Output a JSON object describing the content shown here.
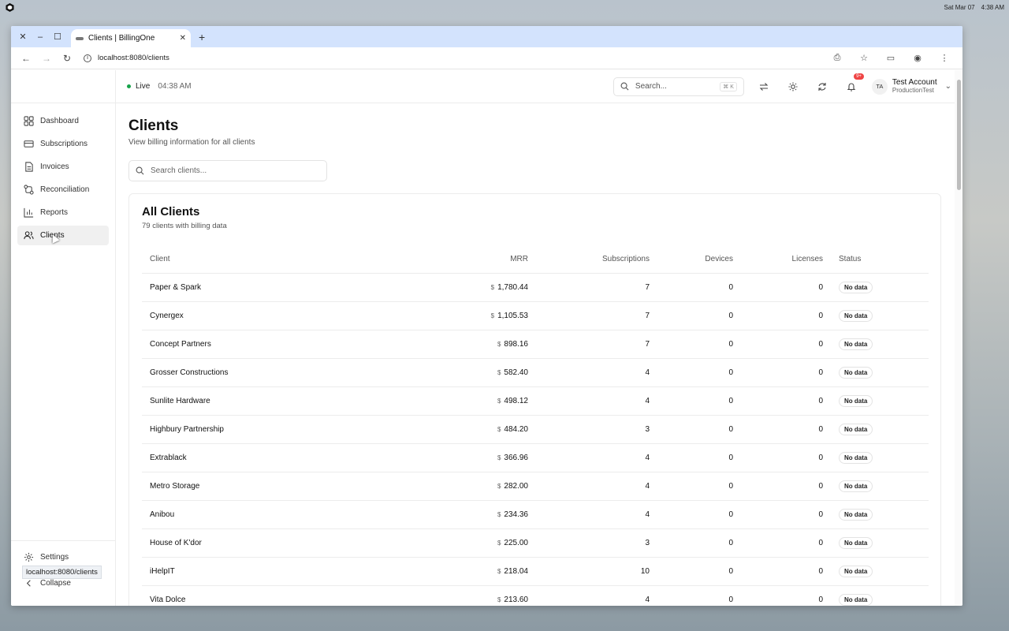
{
  "os": {
    "date": "Sat Mar 07",
    "time": "4:38 AM"
  },
  "browser": {
    "tab_title": "Clients | BillingOne",
    "url": "localhost:8080/clients",
    "status_url": "localhost:8080/clients"
  },
  "sidebar": {
    "items": [
      {
        "label": "Dashboard",
        "icon": "dashboard-icon"
      },
      {
        "label": "Subscriptions",
        "icon": "card-icon"
      },
      {
        "label": "Invoices",
        "icon": "document-icon"
      },
      {
        "label": "Reconciliation",
        "icon": "reconcile-icon"
      },
      {
        "label": "Reports",
        "icon": "chart-icon"
      },
      {
        "label": "Clients",
        "icon": "users-icon",
        "active": true
      }
    ],
    "settings_label": "Settings",
    "collapse_label": "Collapse"
  },
  "topbar": {
    "live_label": "Live",
    "time": "04:38 AM",
    "search_placeholder": "Search...",
    "search_shortcut": "⌘ K",
    "notifications_badge": "9+",
    "account_initials": "TA",
    "account_name": "Test Account",
    "account_sub": "ProductionTest"
  },
  "page": {
    "title": "Clients",
    "subtitle": "View billing information for all clients",
    "search_placeholder": "Search clients..."
  },
  "card": {
    "title": "All Clients",
    "subtitle": "79 clients with billing data"
  },
  "table": {
    "headers": [
      "Client",
      "MRR",
      "Subscriptions",
      "Devices",
      "Licenses",
      "Status"
    ],
    "currency": "$",
    "rows": [
      {
        "client": "Paper & Spark",
        "mrr": "1,780.44",
        "subs": "7",
        "devices": "0",
        "licenses": "0",
        "status": "No data"
      },
      {
        "client": "Cynergex",
        "mrr": "1,105.53",
        "subs": "7",
        "devices": "0",
        "licenses": "0",
        "status": "No data"
      },
      {
        "client": "Concept Partners",
        "mrr": "898.16",
        "subs": "7",
        "devices": "0",
        "licenses": "0",
        "status": "No data"
      },
      {
        "client": "Grosser Constructions",
        "mrr": "582.40",
        "subs": "4",
        "devices": "0",
        "licenses": "0",
        "status": "No data"
      },
      {
        "client": "Sunlite Hardware",
        "mrr": "498.12",
        "subs": "4",
        "devices": "0",
        "licenses": "0",
        "status": "No data"
      },
      {
        "client": "Highbury Partnership",
        "mrr": "484.20",
        "subs": "3",
        "devices": "0",
        "licenses": "0",
        "status": "No data"
      },
      {
        "client": "Extrablack",
        "mrr": "366.96",
        "subs": "4",
        "devices": "0",
        "licenses": "0",
        "status": "No data"
      },
      {
        "client": "Metro Storage",
        "mrr": "282.00",
        "subs": "4",
        "devices": "0",
        "licenses": "0",
        "status": "No data"
      },
      {
        "client": "Anibou",
        "mrr": "234.36",
        "subs": "4",
        "devices": "0",
        "licenses": "0",
        "status": "No data"
      },
      {
        "client": "House of K'dor",
        "mrr": "225.00",
        "subs": "3",
        "devices": "0",
        "licenses": "0",
        "status": "No data"
      },
      {
        "client": "iHelpIT",
        "mrr": "218.04",
        "subs": "10",
        "devices": "0",
        "licenses": "0",
        "status": "No data"
      },
      {
        "client": "Vita Dolce",
        "mrr": "213.60",
        "subs": "4",
        "devices": "0",
        "licenses": "0",
        "status": "No data"
      }
    ]
  }
}
